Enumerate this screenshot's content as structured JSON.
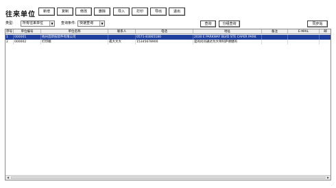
{
  "page": {
    "title": "往来单位"
  },
  "toolbar": {
    "add": "新增",
    "copy": "复制",
    "edit": "修改",
    "delete": "删除",
    "import": "导入",
    "print": "打印",
    "export": "导出",
    "exit": "退出"
  },
  "filter": {
    "type_label": "类型:",
    "type_value": "所有往来单位",
    "cond_label": "查询条件:",
    "cond_value": "快速查询",
    "query_button": "查询",
    "filter_button": "分组查询",
    "sync_button": "同步站"
  },
  "grid": {
    "columns": [
      "序号",
      "单位编号",
      "单位名称",
      "联系人",
      "电话",
      "地址",
      "备注",
      "E-MAIL",
      "邮"
    ],
    "rows": [
      [
        "1",
        "000001",
        "杭州首新技软件有限公司",
        "",
        "0571-83065180",
        "2030 E PARKWAY BLVD STE CAPER PARK",
        "",
        "",
        ""
      ],
      [
        "2",
        "000002",
        "打印端",
        "孤大大大",
        "15345678900",
        "是的问问通达为大师阿萨德健的",
        "",
        "",
        ""
      ]
    ],
    "selected_row": 1
  },
  "colors": {
    "selection": "#1e3f9e",
    "header_bg": "#efefef"
  }
}
